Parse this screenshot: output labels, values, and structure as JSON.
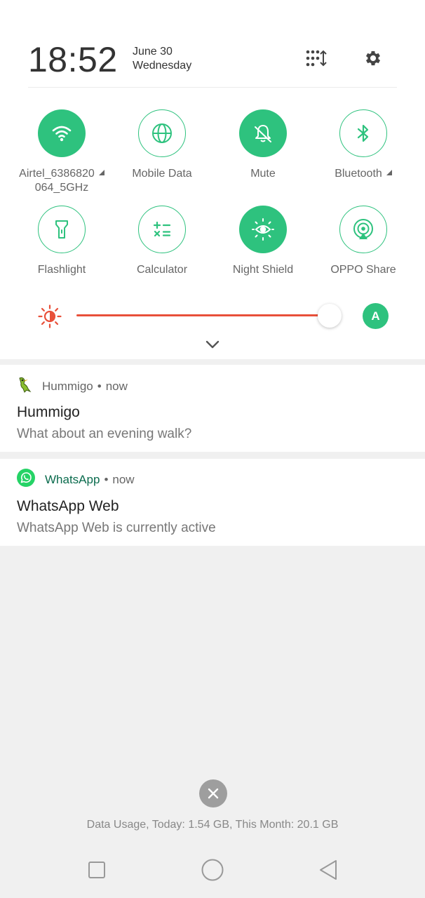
{
  "header": {
    "time": "18:52",
    "date": "June 30",
    "day": "Wednesday",
    "edit_icon": "grid-sort-icon",
    "settings_icon": "gear-icon"
  },
  "tiles": [
    {
      "label": "Airtel_6386820",
      "label2": "064_5GHz",
      "state": "on",
      "icon": "wifi-icon",
      "expandable": true
    },
    {
      "label": "Mobile Data",
      "state": "off",
      "icon": "globe-icon"
    },
    {
      "label": "Mute",
      "state": "on",
      "icon": "bell-off-icon"
    },
    {
      "label": "Bluetooth",
      "state": "off",
      "icon": "bluetooth-icon",
      "expandable": true
    },
    {
      "label": "Flashlight",
      "state": "off",
      "icon": "flashlight-icon"
    },
    {
      "label": "Calculator",
      "state": "off",
      "icon": "calculator-icon"
    },
    {
      "label": "Night Shield",
      "state": "on",
      "icon": "eye-sun-icon"
    },
    {
      "label": "OPPO Share",
      "state": "off",
      "icon": "share-signal-icon"
    }
  ],
  "brightness": {
    "level": 0.96,
    "auto_label": "A"
  },
  "notifications": [
    {
      "app": "Hummigo",
      "time": "now",
      "title": "Hummigo",
      "body": "What about an evening walk?"
    },
    {
      "app": "WhatsApp",
      "time": "now",
      "title": "WhatsApp Web",
      "body": "WhatsApp Web is currently active"
    }
  ],
  "separator": "•",
  "footer": {
    "data_usage": "Data Usage, Today: 1.54 GB, This Month: 20.1 GB"
  },
  "colors": {
    "accent": "#2ec27e",
    "brightness": "#e8503a",
    "whatsapp": "#25d366"
  }
}
